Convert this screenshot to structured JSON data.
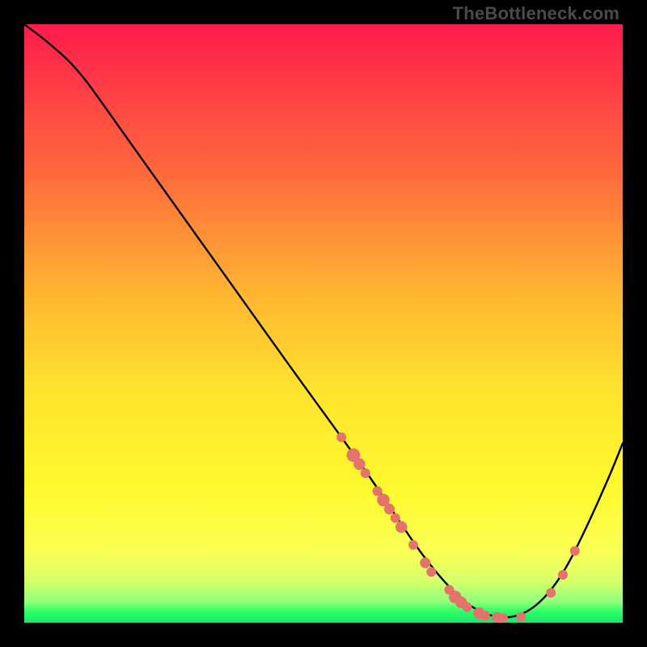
{
  "watermark": "TheBottleneck.com",
  "chart_data": {
    "type": "line",
    "title": "",
    "xlabel": "",
    "ylabel": "",
    "xlim": [
      0,
      100
    ],
    "ylim": [
      0,
      100
    ],
    "grid": false,
    "curve": [
      {
        "x": 0,
        "y": 100
      },
      {
        "x": 4,
        "y": 97
      },
      {
        "x": 9,
        "y": 92.5
      },
      {
        "x": 15,
        "y": 84
      },
      {
        "x": 25,
        "y": 70
      },
      {
        "x": 35,
        "y": 56
      },
      {
        "x": 45,
        "y": 42
      },
      {
        "x": 53,
        "y": 31
      },
      {
        "x": 58,
        "y": 24
      },
      {
        "x": 62,
        "y": 18
      },
      {
        "x": 66,
        "y": 12
      },
      {
        "x": 70,
        "y": 7
      },
      {
        "x": 74,
        "y": 3
      },
      {
        "x": 78,
        "y": 1
      },
      {
        "x": 82,
        "y": 0.8
      },
      {
        "x": 86,
        "y": 3
      },
      {
        "x": 90,
        "y": 8
      },
      {
        "x": 94,
        "y": 16
      },
      {
        "x": 98,
        "y": 25
      },
      {
        "x": 100,
        "y": 30
      }
    ],
    "dots": [
      {
        "x": 53,
        "y": 31,
        "r": 1.0
      },
      {
        "x": 55,
        "y": 28,
        "r": 1.4
      },
      {
        "x": 56,
        "y": 26.5,
        "r": 1.2
      },
      {
        "x": 57,
        "y": 25,
        "r": 1.0
      },
      {
        "x": 59,
        "y": 22,
        "r": 1.0
      },
      {
        "x": 60,
        "y": 20.5,
        "r": 1.3
      },
      {
        "x": 61,
        "y": 19,
        "r": 1.1
      },
      {
        "x": 62,
        "y": 17.5,
        "r": 1.0
      },
      {
        "x": 63,
        "y": 16,
        "r": 1.2
      },
      {
        "x": 65,
        "y": 13,
        "r": 1.0
      },
      {
        "x": 67,
        "y": 10,
        "r": 1.1
      },
      {
        "x": 68,
        "y": 8.5,
        "r": 1.0
      },
      {
        "x": 71,
        "y": 5.5,
        "r": 1.0
      },
      {
        "x": 72,
        "y": 4.3,
        "r": 1.3
      },
      {
        "x": 73,
        "y": 3.4,
        "r": 1.2
      },
      {
        "x": 74,
        "y": 2.6,
        "r": 1.0
      },
      {
        "x": 76,
        "y": 1.6,
        "r": 1.2
      },
      {
        "x": 77,
        "y": 1.2,
        "r": 1.0
      },
      {
        "x": 79,
        "y": 0.9,
        "r": 1.1
      },
      {
        "x": 80,
        "y": 0.8,
        "r": 1.0
      },
      {
        "x": 83,
        "y": 1.0,
        "r": 1.0
      },
      {
        "x": 88,
        "y": 5,
        "r": 1.0
      },
      {
        "x": 90,
        "y": 8,
        "r": 1.0
      },
      {
        "x": 92,
        "y": 12,
        "r": 1.0
      }
    ],
    "dot_color": "#e5736b",
    "line_color": "#000000"
  }
}
